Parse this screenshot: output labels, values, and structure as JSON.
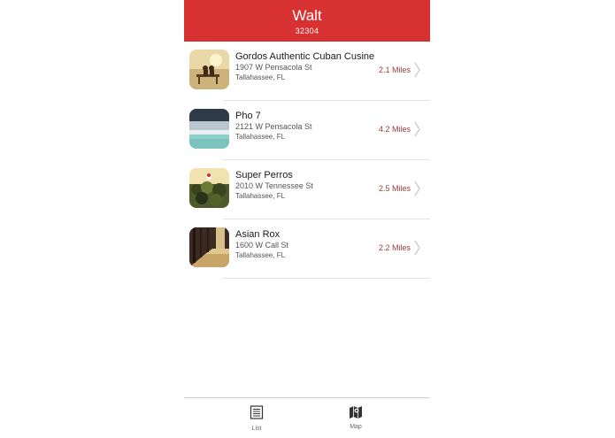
{
  "header": {
    "title": "Walt",
    "subtitle": "32304"
  },
  "restaurants": [
    {
      "name": "Gordos Authentic Cuban Cusine",
      "address": "1907 W Pensacola St",
      "city": "Tallahassee, FL",
      "distance": "2.1 Miles"
    },
    {
      "name": "Pho 7",
      "address": "2121 W Pensacola St",
      "city": "Tallahassee, FL",
      "distance": "4.2 Miles"
    },
    {
      "name": "Super Perros",
      "address": "2010 W Tennessee St",
      "city": "Tallahassee, FL",
      "distance": "2.5 Miles"
    },
    {
      "name": "Asian Rox",
      "address": "1600 W Call St",
      "city": "Tallahassee, FL",
      "distance": "2.2 Miles"
    }
  ],
  "tabs": [
    {
      "label": "List",
      "icon": "list-icon"
    },
    {
      "label": "Map",
      "icon": "map-icon"
    }
  ],
  "colors": {
    "brand": "#d73131",
    "distance": "#9c3b3b"
  }
}
